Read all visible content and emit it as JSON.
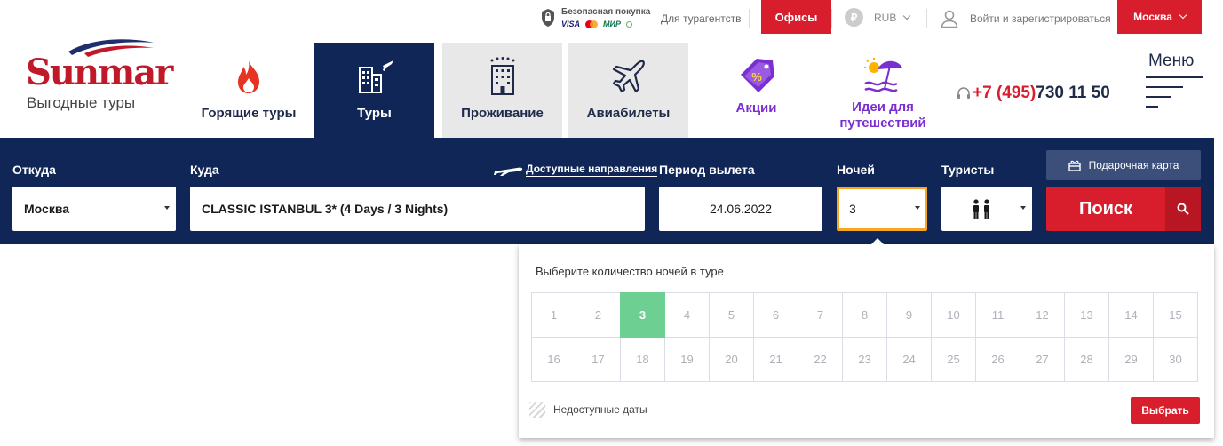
{
  "topbar": {
    "secure_purchase": "Безопасная покупка",
    "payment_systems": [
      "VISA",
      "MasterCard",
      "МИР",
      "СБП"
    ],
    "for_agents": "Для турагентств",
    "offices": "Офисы",
    "currency": "RUB",
    "currency_icon": "ruble-coin-icon",
    "login": "Войти и зарегистрироваться",
    "city": "Москва"
  },
  "logo": {
    "brand": "Sunmar",
    "slogan": "Выгодные туры"
  },
  "nav": {
    "hot": "Горящие туры",
    "tours": "Туры",
    "stay": "Проживание",
    "avia": "Авиабилеты",
    "promo": "Акции",
    "ideas": "Идеи для путешествий"
  },
  "phone": {
    "prefix": "+7 (495)",
    "number": "730 11 50"
  },
  "menu_label": "Меню",
  "search": {
    "from_label": "Откуда",
    "from_value": "Москва",
    "to_label": "Куда",
    "to_value": "CLASSIC ISTANBUL 3* (4 Days / 3 Nights)",
    "destinations_link": "Доступные направления",
    "period_label": "Период вылета",
    "period_value": "24.06.2022",
    "nights_label": "Ночей",
    "nights_value": "3",
    "tourists_label": "Туристы",
    "gift_card": "Подарочная карта",
    "search_button": "Поиск"
  },
  "nights_popup": {
    "title": "Выберите количество ночей в туре",
    "row1": [
      "1",
      "2",
      "3",
      "4",
      "5",
      "6",
      "7",
      "8",
      "9",
      "10",
      "11",
      "12",
      "13",
      "14",
      "15"
    ],
    "row2": [
      "16",
      "17",
      "18",
      "19",
      "20",
      "21",
      "22",
      "23",
      "24",
      "25",
      "26",
      "27",
      "28",
      "29",
      "30"
    ],
    "selected": "3",
    "legend": "Недоступные даты",
    "choose_button": "Выбрать"
  },
  "colors": {
    "brand_red": "#d81e2c",
    "navy": "#0f2656",
    "selected_green": "#6dcf92",
    "promo_purple": "#7b2fd0"
  }
}
